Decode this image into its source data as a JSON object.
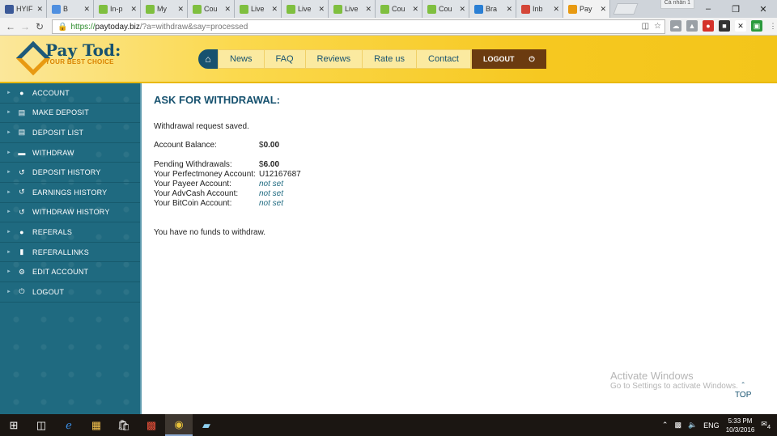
{
  "browser": {
    "tabs": [
      {
        "title": "HYIF",
        "color": "#3b5998"
      },
      {
        "title": "B",
        "color": "#4f8fe0"
      },
      {
        "title": "In-p",
        "color": "#7fbf3f"
      },
      {
        "title": "My",
        "color": "#7fbf3f"
      },
      {
        "title": "Cou",
        "color": "#7fbf3f"
      },
      {
        "title": "Live",
        "color": "#7fbf3f"
      },
      {
        "title": "Live",
        "color": "#7fbf3f"
      },
      {
        "title": "Live",
        "color": "#7fbf3f"
      },
      {
        "title": "Cou",
        "color": "#7fbf3f"
      },
      {
        "title": "Cou",
        "color": "#7fbf3f"
      },
      {
        "title": "Bra",
        "color": "#2a7fd4"
      },
      {
        "title": "Inb",
        "color": "#d44638"
      },
      {
        "title": "Pay",
        "color": "#e89a12"
      }
    ],
    "profile": "Cá nhân 1",
    "url_scheme": "https://",
    "url_host": "paytoday.biz",
    "url_path": "/?a=withdraw&say=processed"
  },
  "header": {
    "logo_name": "Pay Tod:",
    "logo_tagline": "YOUR BEST CHOICE",
    "nav": [
      "News",
      "FAQ",
      "Reviews",
      "Rate us",
      "Contact"
    ],
    "logout_label": "LOGOUT"
  },
  "sidebar": {
    "items": [
      {
        "label": "ACCOUNT",
        "icon": "user-icon"
      },
      {
        "label": "MAKE DEPOSIT",
        "icon": "deposit-icon"
      },
      {
        "label": "DEPOSIT LIST",
        "icon": "list-icon"
      },
      {
        "label": "WITHDRAW",
        "icon": "card-icon"
      },
      {
        "label": "DEPOSIT HISTORY",
        "icon": "history-icon"
      },
      {
        "label": "EARNINGS HISTORY",
        "icon": "history-icon"
      },
      {
        "label": "WITHDRAW HISTORY",
        "icon": "history-icon"
      },
      {
        "label": "REFERALS",
        "icon": "users-icon"
      },
      {
        "label": "REFERALLINKS",
        "icon": "bookmark-icon"
      },
      {
        "label": "EDIT ACCOUNT",
        "icon": "gear-icon"
      },
      {
        "label": "LOGOUT",
        "icon": "power-icon"
      }
    ]
  },
  "main": {
    "title": "ASK FOR WITHDRAWAL:",
    "saved_message": "Withdrawal request saved.",
    "balance_label": "Account Balance:",
    "balance_currency": "$",
    "balance_value": "0.00",
    "pending_label": "Pending Withdrawals:",
    "pending_currency": "$",
    "pending_value": "6.00",
    "perfectmoney_label": "Your Perfectmoney Account:",
    "perfectmoney_value": "U12167687",
    "payeer_label": "Your Payeer Account:",
    "payeer_value": "not set",
    "advcash_label": "Your AdvCash Account:",
    "advcash_value": "not set",
    "bitcoin_label": "Your BitCoin Account:",
    "bitcoin_value": "not set",
    "no_funds": "You have no funds to withdraw."
  },
  "watermark": {
    "line1": "Activate Windows",
    "line2": "Go to Settings to activate Windows."
  },
  "top_link": "TOP",
  "taskbar": {
    "lang": "ENG",
    "time": "5:33 PM",
    "date": "10/3/2016",
    "notifications": "4"
  }
}
